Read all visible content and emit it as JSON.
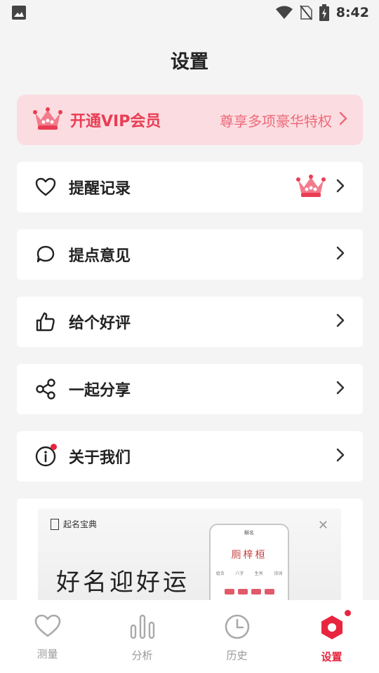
{
  "status_bar": {
    "time": "8:42",
    "icons": [
      "gallery-icon",
      "wifi-icon",
      "no-sim-icon",
      "battery-charging-icon"
    ]
  },
  "page": {
    "title": "设置"
  },
  "vip": {
    "title": "开通VIP会员",
    "subtitle": "尊享多项豪华特权",
    "accent_color": "#ea3d54",
    "background_color": "#fbdde1"
  },
  "menu": {
    "items": [
      {
        "label": "提醒记录",
        "icon": "heart-icon",
        "has_vip_badge": true
      },
      {
        "label": "提点意见",
        "icon": "chat-bubble-icon"
      },
      {
        "label": "给个好评",
        "icon": "thumbs-up-icon"
      },
      {
        "label": "一起分享",
        "icon": "share-icon"
      },
      {
        "label": "关于我们",
        "icon": "info-icon",
        "has_notification_dot": true
      }
    ]
  },
  "ad": {
    "brand": "起名宝典",
    "slogan": "好名迎好运",
    "phone_top": "解名",
    "phone_name": "厕梓桓",
    "phone_row": [
      "组合",
      "八字",
      "生肖",
      "诗词"
    ]
  },
  "tabbar": {
    "items": [
      {
        "label": "测量",
        "icon": "heart-icon"
      },
      {
        "label": "分析",
        "icon": "bar-chart-icon"
      },
      {
        "label": "历史",
        "icon": "clock-icon"
      },
      {
        "label": "设置",
        "icon": "hexagon-settings-icon",
        "active": true
      }
    ],
    "active_color": "#e8253f"
  }
}
